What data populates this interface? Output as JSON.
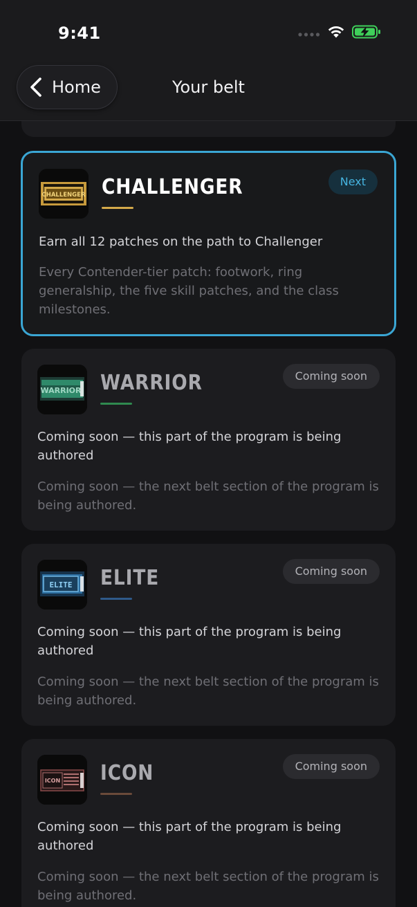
{
  "status_bar": {
    "time": "9:41",
    "icons": [
      "cellular-dots-icon",
      "wifi-icon",
      "battery-charging-icon"
    ],
    "battery_color": "#3fd05a"
  },
  "nav": {
    "back_label": "Home",
    "title": "Your belt"
  },
  "colors": {
    "active_border": "#3aa6d4",
    "next_badge_text": "#46b4e0"
  },
  "belts": [
    {
      "name": "CHALLENGER",
      "badge": "Next",
      "goal": "Earn all 12 patches on the path to Challenger",
      "description": "Every Contender-tier patch: footwork, ring generalship, the five skill patches, and the class milestones.",
      "patch_label": "CHALLENGER",
      "accent": "#d4a94a"
    },
    {
      "name": "WARRIOR",
      "badge": "Coming soon",
      "goal": "Coming soon — this part of the program is being authored",
      "description": "Coming soon — the next belt section of the program is being authored.",
      "patch_label": "WARRIOR",
      "accent": "#2f8a6a"
    },
    {
      "name": "ELITE",
      "badge": "Coming soon",
      "goal": "Coming soon — this part of the program is being authored",
      "description": "Coming soon — the next belt section of the program is being authored.",
      "patch_label": "ELITE",
      "accent": "#3c7fb0"
    },
    {
      "name": "ICON",
      "badge": "Coming soon",
      "goal": "Coming soon — this part of the program is being authored",
      "description": "Coming soon — the next belt section of the program is being authored.",
      "patch_label": "ICON",
      "accent": "#8a4a4a"
    }
  ]
}
